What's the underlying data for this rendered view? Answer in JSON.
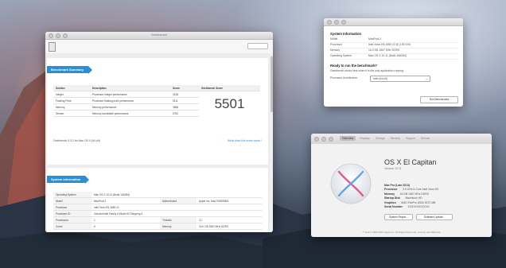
{
  "main_window": {
    "title": "Geekbench",
    "summary_banner": "Benchmark Summary",
    "summary_headers": [
      "Section",
      "Description",
      "Score",
      "Geekbench Score"
    ],
    "summary_rows": [
      {
        "section": "Integer",
        "description": "Processor integer performance",
        "score": "4138"
      },
      {
        "section": "Floating Point",
        "description": "Processor floating point performance",
        "score": "5111"
      },
      {
        "section": "Memory",
        "description": "Memory performance",
        "score": "3568"
      },
      {
        "section": "Stream",
        "description": "Memory bandwidth performance",
        "score": "2762"
      }
    ],
    "geekbench_score": "5501",
    "footer_left": "Geekbench 3.3.2 for Mac OS X (64-bit)",
    "footer_link": "What does this score mean?",
    "sysinfo_banner": "System Information",
    "sysinfo_rows": [
      {
        "k1": "Operating System",
        "v1": "Mac OS X 10.11 (Build 15A284)",
        "k2": "",
        "v2": ""
      },
      {
        "k1": "Model",
        "v1": "MacPro6,1",
        "k2": "Motherboard",
        "v2": "Apple Inc. Mac-F60DEB81"
      },
      {
        "k1": "Processor",
        "v1": "Intel Xeon E5-1650 v2",
        "k2": "",
        "v2": ""
      },
      {
        "k1": "Processor ID",
        "v1": "GenuineIntel Family 6 Model 62 Stepping 4",
        "k2": "",
        "v2": ""
      },
      {
        "k1": "Processors",
        "v1": "1",
        "k2": "Threads",
        "v2": "12"
      },
      {
        "k1": "Cores",
        "v1": "6",
        "k2": "Memory",
        "v2": "16.0 GB 1867 MHz DDR3"
      }
    ]
  },
  "sysinfo_window": {
    "section_title": "System Information",
    "rows": [
      {
        "label": "Model",
        "value": "MacPro6,1"
      },
      {
        "label": "Processor",
        "value": "Intel Xeon E5-1650 v2 @ 3.50 GHz"
      },
      {
        "label": "Memory",
        "value": "16.0 GB 1867 MHz DDR3"
      },
      {
        "label": "Operating System",
        "value": "Mac OS X 10.11 (Build 15A284)"
      }
    ],
    "ready_title": "Ready to run the benchmark?",
    "ready_text": "Geekbench works best when it is the only application running.",
    "arch_label": "Processor Architecture",
    "arch_value": "Intel (64-bit)",
    "run_button": "Run Benchmarks"
  },
  "about_window": {
    "tabs": [
      "Overview",
      "Displays",
      "Storage",
      "Memory",
      "Support",
      "Service"
    ],
    "os_name": "OS X El Capitan",
    "os_version": "Version 10.11",
    "specs": [
      {
        "label": "Mac Pro (Late 2013)",
        "value": ""
      },
      {
        "label": "Processor",
        "value": "3.5 GHz 6-Core Intel Xeon E5"
      },
      {
        "label": "Memory",
        "value": "16 GB 1867 MHz DDR3"
      },
      {
        "label": "Startup Disk",
        "value": "Macintosh HD"
      },
      {
        "label": "Graphics",
        "value": "AMD FirePro D500 3072 MB"
      },
      {
        "label": "Serial Number",
        "value": "XXXXXXXXXXXX"
      }
    ],
    "button_report": "System Report...",
    "button_update": "Software Update...",
    "footer": "™ and © 1983-2015 Apple Inc. All Rights Reserved. License and Warranty"
  },
  "colors": {
    "accent": "#2b8fd6"
  }
}
